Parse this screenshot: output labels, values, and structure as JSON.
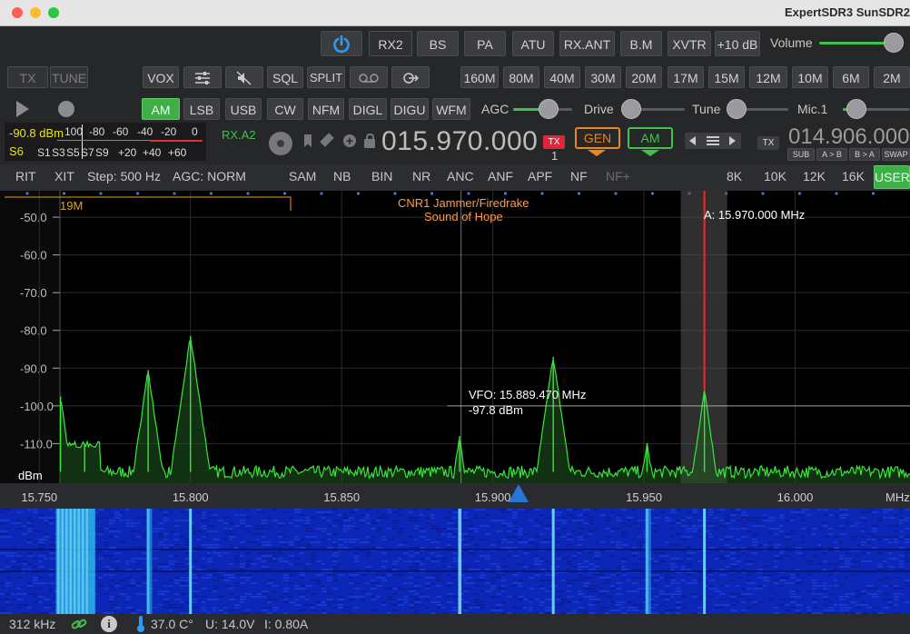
{
  "window": {
    "title": "ExpertSDR3 SunSDR2",
    "colors": {
      "close": "#fd5e57",
      "minimize": "#febb2e",
      "zoom": "#2ac840"
    }
  },
  "row1": {
    "power_icon": "power-icon",
    "buttons": [
      "RX2",
      "BS",
      "PA",
      "ATU",
      "RX.ANT",
      "B.M",
      "XVTR",
      "+10 dB"
    ],
    "volume_label": "Volume",
    "volume_level": 0.95
  },
  "row2": {
    "tx": "TX",
    "tune": "TUNE",
    "vox": "VOX",
    "sql": "SQL",
    "split": "SPLIT",
    "bands": [
      "160M",
      "80M",
      "40M",
      "30M",
      "20M",
      "17M",
      "15M",
      "12M",
      "10M",
      "6M",
      "2M"
    ]
  },
  "row3": {
    "modes": [
      "AM",
      "LSB",
      "USB",
      "CW",
      "NFM",
      "DIGL",
      "DIGU",
      "WFM"
    ],
    "active_mode": "AM",
    "agc_label": "AGC",
    "agc_level": 0.6,
    "drive_label": "Drive",
    "drive_level": 0.0,
    "tune_label": "Tune",
    "tune_level": 0.0,
    "mic_label": "Mic.1",
    "mic_level": 0.2
  },
  "meter": {
    "dbm": "-90.8 dBm",
    "s_value": "S6",
    "scale_top": [
      "100",
      "-80",
      "-60",
      "-40",
      "-20",
      "0"
    ],
    "scale_bottom": [
      "S1",
      "S3",
      "S5",
      "S7",
      "S9",
      "+20",
      "+40",
      "+60"
    ]
  },
  "vfo": {
    "rx_label": "RX.A2",
    "frequency": "015.970.000",
    "tx_badge": "TX",
    "tx_num": "1",
    "gen": "GEN",
    "mode": "AM",
    "tx_label": "TX",
    "sub_frequency": "014.906.000",
    "sub_buttons": [
      "SUB",
      "A > B",
      "B > A",
      "SWAP"
    ]
  },
  "row5": {
    "rit": "RIT",
    "xit": "XIT",
    "step": "Step: 500 Hz",
    "agc": "AGC: NORM",
    "dsp": [
      "SAM",
      "NB",
      "BIN",
      "NR",
      "ANC",
      "ANF",
      "APF",
      "NF",
      "NF+"
    ],
    "filters": [
      "8K",
      "10K",
      "12K",
      "16K",
      "USER"
    ],
    "active_filter": "USER"
  },
  "spectrum": {
    "band_label": "19M",
    "station_line1": "CNR1 Jammer/Firedrake",
    "station_line2": "Sound of Hope",
    "vfo_marker": "A: 15.970.000 MHz",
    "cursor_freq": "VFO: 15.889.470 MHz",
    "cursor_level": "-97.8 dBm",
    "y_unit": "dBm",
    "colors": {
      "trace": "#39e63b",
      "marker": "#ff2020",
      "label": "#ff9a50",
      "band": "#e3a21a"
    }
  },
  "chart_data": {
    "type": "line",
    "title": "",
    "xlabel": "MHz",
    "ylabel": "dBm",
    "xlim": [
      15.737,
      16.038
    ],
    "ylim": [
      -120.5,
      -43
    ],
    "y_ticks": [
      "-50.0",
      "-60.0",
      "-70.0",
      "-80.0",
      "-90.0",
      "-100.0",
      "-110.0"
    ],
    "y_tick_values": [
      -50,
      -60,
      -70,
      -80,
      -90,
      -100,
      -110
    ],
    "x_ticks": [
      "15.750",
      "15.800",
      "15.850",
      "15.900",
      "15.950",
      "16.000"
    ],
    "x_tick_values": [
      15.75,
      15.8,
      15.85,
      15.9,
      15.95,
      16.0
    ],
    "noise_floor": -117.5,
    "peaks": [
      {
        "x": 15.757,
        "y": -97.5
      },
      {
        "x": 15.765,
        "y": -110.0
      },
      {
        "x": 15.786,
        "y": -90.5
      },
      {
        "x": 15.8,
        "y": -81.5
      },
      {
        "x": 15.889,
        "y": -108.0
      },
      {
        "x": 15.92,
        "y": -87.0
      },
      {
        "x": 15.951,
        "y": -110.0
      },
      {
        "x": 15.97,
        "y": -96.0
      }
    ],
    "vfo_marker_x": 15.97,
    "cursor": {
      "x": 15.8895,
      "y": -100.0
    }
  },
  "status": {
    "bandwidth": "312 kHz",
    "temperature": "37.0 C°",
    "voltage": "U: 14.0V",
    "current": "I: 0.80A"
  }
}
